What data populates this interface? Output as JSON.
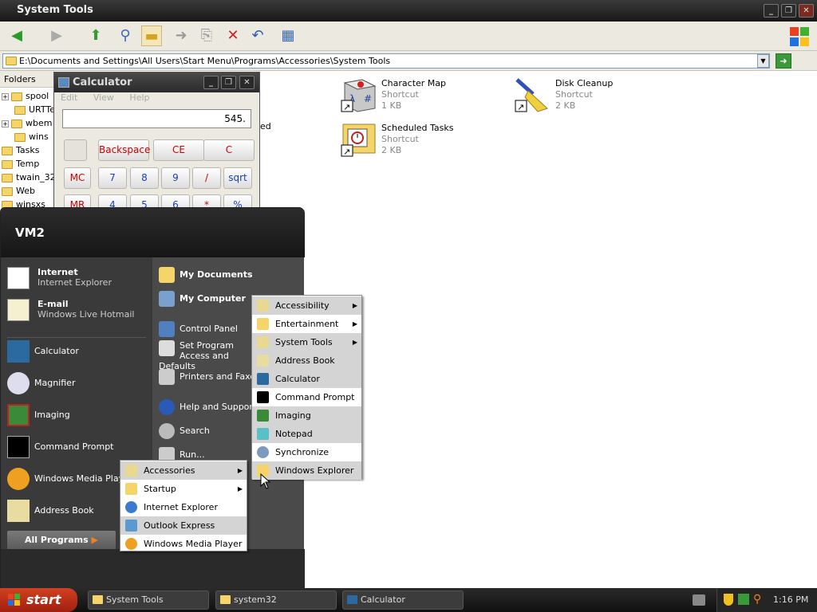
{
  "explorer": {
    "title": "System Tools",
    "address": "E:\\Documents and Settings\\All Users\\Start Menu\\Programs\\Accessories\\System Tools",
    "folders_label": "Folders",
    "tree": [
      "spool",
      "URTTe",
      "wbem",
      "wins",
      "Tasks",
      "Temp",
      "twain_32",
      "Web",
      "winsxs"
    ],
    "files": [
      {
        "name": "Character Map",
        "type": "Shortcut",
        "size": "1 KB"
      },
      {
        "name": "Disk Cleanup",
        "type": "Shortcut",
        "size": "2 KB"
      },
      {
        "name": "Scheduled Tasks",
        "type": "Shortcut",
        "size": "2 KB"
      }
    ],
    "hidden_fragment": "ed"
  },
  "calculator": {
    "title": "Calculator",
    "menu": [
      "Edit",
      "View",
      "Help"
    ],
    "display": "545.",
    "top_buttons": [
      "Backspace",
      "CE",
      "C"
    ],
    "row1": [
      "MC",
      "7",
      "8",
      "9",
      "/",
      "sqrt"
    ],
    "row2": [
      "MR",
      "4",
      "5",
      "6",
      "*",
      "%"
    ]
  },
  "start_menu": {
    "user": "VM2",
    "pinned": [
      {
        "title": "Internet",
        "sub": "Internet Explorer"
      },
      {
        "title": "E-mail",
        "sub": "Windows Live Hotmail"
      }
    ],
    "recent": [
      "Calculator",
      "Magnifier",
      "Imaging",
      "Command Prompt",
      "Windows Media Player",
      "Address Book"
    ],
    "right_bold": [
      "My Documents",
      "My Computer"
    ],
    "right_items": [
      "Control Panel",
      "Set Program Access and Defaults",
      "Printers and Faxes",
      "Help and Support",
      "Search",
      "Run..."
    ],
    "all_programs": "All Programs"
  },
  "programs_menu": [
    "Accessories",
    "Startup",
    "Internet Explorer",
    "Outlook Express",
    "Windows Media Player"
  ],
  "accessories_menu": [
    "Accessibility",
    "Entertainment",
    "System Tools",
    "Address Book",
    "Calculator",
    "Command Prompt",
    "Imaging",
    "Notepad",
    "Synchronize",
    "Windows Explorer"
  ],
  "taskbar": {
    "start": "start",
    "tasks": [
      "System Tools",
      "system32",
      "Calculator"
    ],
    "clock": "1:16 PM"
  }
}
